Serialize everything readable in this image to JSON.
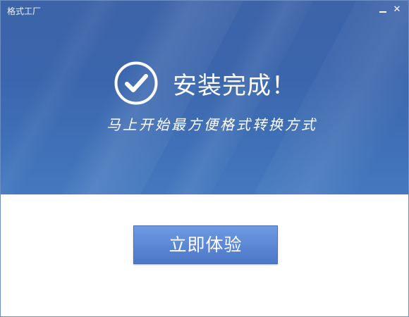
{
  "window": {
    "title": "格式工厂"
  },
  "titlebar_controls": {
    "minimize_icon": "minimize-icon",
    "close_icon": "close-icon",
    "close_glyph": "✕"
  },
  "success": {
    "icon": "check-circle-icon",
    "heading": "安装完成！",
    "subtitle": "马上开始最方便格式转换方式"
  },
  "actions": {
    "primary_label": "立即体验"
  },
  "colors": {
    "header_blue": "#3b66ad",
    "button_blue": "#5a86d4",
    "text_white": "#ffffff"
  }
}
